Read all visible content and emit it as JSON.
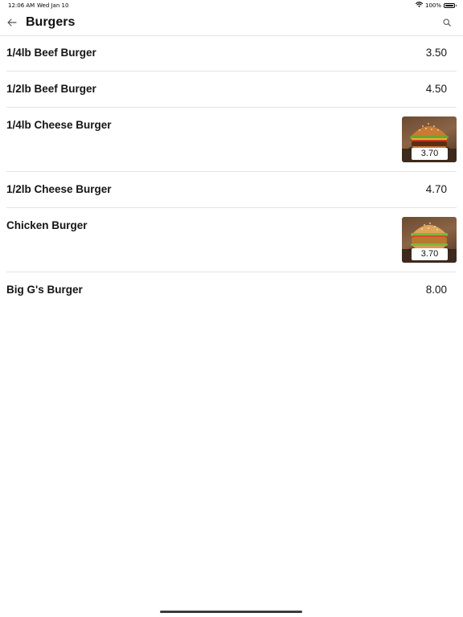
{
  "status_bar": {
    "time": "12:06 AM",
    "date": "Wed Jan 10",
    "battery": "100%"
  },
  "header": {
    "title": "Burgers"
  },
  "menu": [
    {
      "name": "1/4lb Beef Burger",
      "price": "3.50",
      "has_image": false
    },
    {
      "name": "1/2lb Beef Burger",
      "price": "4.50",
      "has_image": false
    },
    {
      "name": "1/4lb Cheese Burger",
      "price": "3.70",
      "has_image": true
    },
    {
      "name": "1/2lb Cheese Burger",
      "price": "4.70",
      "has_image": false
    },
    {
      "name": "Chicken Burger",
      "price": "3.70",
      "has_image": true
    },
    {
      "name": "Big G's Burger",
      "price": "8.00",
      "has_image": false
    }
  ],
  "icons": {
    "back": "arrow-left-icon",
    "search": "search-icon",
    "wifi": "wifi-icon",
    "battery": "battery-icon"
  }
}
